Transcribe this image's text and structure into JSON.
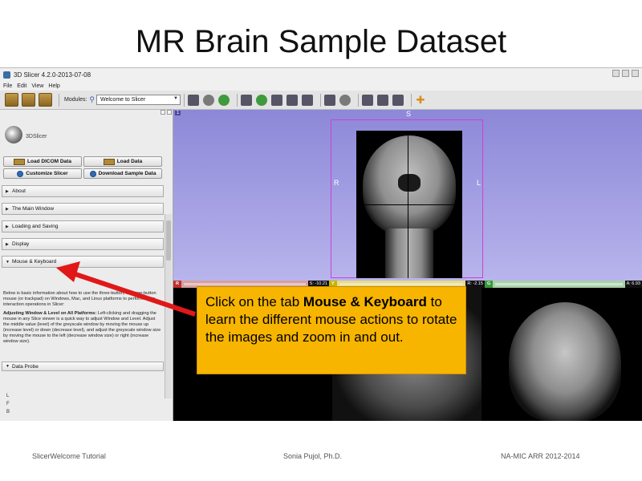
{
  "slide": {
    "title": "MR Brain Sample Dataset",
    "footer_left": "SlicerWelcome Tutorial",
    "footer_center": "Sonia Pujol, Ph.D.",
    "footer_right": "NA-MIC ARR 2012-2014"
  },
  "window": {
    "title": "3D Slicer 4.2.0-2013-07-08"
  },
  "menu": {
    "file": "File",
    "edit": "Edit",
    "view": "View",
    "help": "Help"
  },
  "toolbar": {
    "modules_label": "Modules:",
    "module_selected": "Welcome to Slicer"
  },
  "panel": {
    "logo_text": "3DSlicer",
    "load_dicom": "Load DICOM Data",
    "load_data": "Load Data",
    "customize": "Customize Slicer",
    "download_sample": "Download Sample Data",
    "sections": [
      "About",
      "The Main Window",
      "Loading and Saving",
      "Display",
      "Mouse & Keyboard",
      "Data Probe"
    ],
    "body_intro": "Below is basic information about how to use the three-button, and one-button mouse (or trackpad) on Windows, Mac, and Linux platforms to perform basic interaction operations in Slicer:",
    "body_heading": "Adjusting Window & Level on All Platforms:",
    "body_detail": "Left-clicking and dragging the mouse in any Slice viewer is a quick way to adjust Window and Level. Adjust the middle value (level) of the greyscale window by moving the mouse up (increase level) or down (decrease level), and adjust the greyscale window size by moving the mouse to the left (decrease window size) or right (increase window size).",
    "lfb": [
      "L",
      "F",
      "B"
    ]
  },
  "view3d": {
    "number": "1",
    "superior": "S",
    "right": "R",
    "left": "L"
  },
  "slices": {
    "red": {
      "tag": "R",
      "value": "S: -10.21",
      "color": "#c03030"
    },
    "yellow": {
      "tag": "Y",
      "value": "R: -2.15",
      "color": "#c8b400"
    },
    "green": {
      "tag": "G",
      "value": "A: 6.93",
      "color": "#3a9a3a"
    }
  },
  "callout": {
    "pre": "Click on the tab ",
    "emph": "Mouse & Keyboard",
    "post": " to learn the different mouse actions to rotate the images and zoom in and out."
  },
  "colors": {
    "callout_bg": "#f7b500",
    "arrow": "#e01818",
    "view3d_bg": "#a09ce0"
  }
}
